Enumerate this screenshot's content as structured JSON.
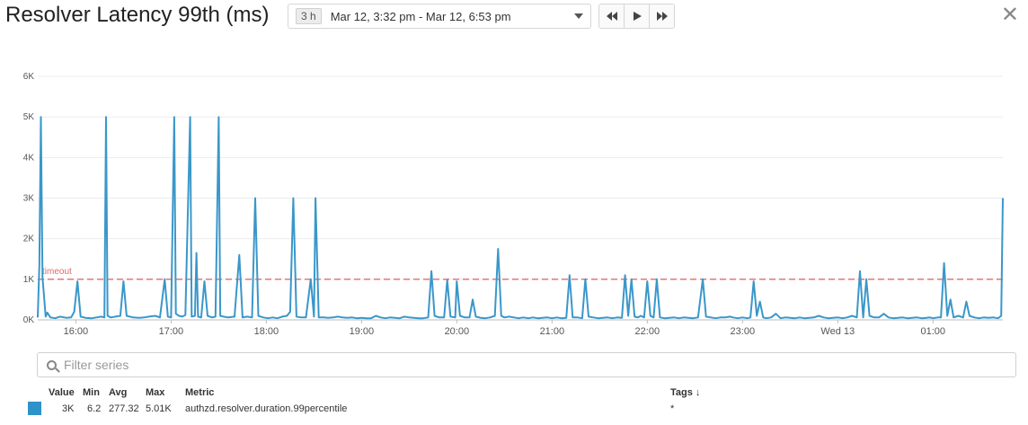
{
  "header": {
    "title": "Resolver Latency 99th (ms)",
    "range_badge": "3 h",
    "range_text": "Mar 12, 3:32 pm - Mar 12, 6:53 pm",
    "rewind_icon": "rewind-icon",
    "play_icon": "play-icon",
    "forward_icon": "fast-forward-icon",
    "close_icon": "close-icon"
  },
  "filter": {
    "placeholder": "Filter series"
  },
  "legend": {
    "headers": {
      "value": "Value",
      "min": "Min",
      "avg": "Avg",
      "max": "Max",
      "metric": "Metric",
      "tags": "Tags ↓"
    },
    "row": {
      "value": "3K",
      "min": "6.2",
      "avg": "277.32",
      "max": "5.01K",
      "metric": "authzd.resolver.duration.99percentile",
      "tags": "*"
    }
  },
  "colors": {
    "series": "#3a97c9",
    "timeout": "#e06a6a",
    "swatch": "#2e92c8",
    "grid": "#ececec"
  },
  "chart_data": {
    "type": "line",
    "ylim": [
      0,
      6000
    ],
    "yticks": [
      "0K",
      "1K",
      "2K",
      "3K",
      "4K",
      "5K",
      "6K"
    ],
    "xticks": [
      "16:00",
      "17:00",
      "18:00",
      "19:00",
      "20:00",
      "21:00",
      "22:00",
      "23:00",
      "Wed 13",
      "01:00"
    ],
    "threshold": {
      "label": "timeout",
      "value": 1000
    },
    "series": [
      {
        "points": [
          [
            "15:36",
            60
          ],
          [
            "15:37",
            1350
          ],
          [
            "15:38",
            5000
          ],
          [
            "15:39",
            1050
          ],
          [
            "15:41",
            80
          ],
          [
            "15:42",
            180
          ],
          [
            "15:44",
            60
          ],
          [
            "15:47",
            40
          ],
          [
            "15:50",
            80
          ],
          [
            "15:54",
            50
          ],
          [
            "15:57",
            60
          ],
          [
            "15:59",
            200
          ],
          [
            "16:01",
            950
          ],
          [
            "16:03",
            80
          ],
          [
            "16:06",
            50
          ],
          [
            "16:10",
            40
          ],
          [
            "16:13",
            60
          ],
          [
            "16:16",
            80
          ],
          [
            "16:18",
            60
          ],
          [
            "16:19",
            5000
          ],
          [
            "16:20",
            100
          ],
          [
            "16:22",
            60
          ],
          [
            "16:25",
            80
          ],
          [
            "16:28",
            100
          ],
          [
            "16:30",
            950
          ],
          [
            "16:32",
            100
          ],
          [
            "16:36",
            60
          ],
          [
            "16:40",
            50
          ],
          [
            "16:43",
            60
          ],
          [
            "16:46",
            80
          ],
          [
            "16:50",
            100
          ],
          [
            "16:53",
            60
          ],
          [
            "16:56",
            1000
          ],
          [
            "16:58",
            80
          ],
          [
            "17:00",
            60
          ],
          [
            "17:02",
            5000
          ],
          [
            "17:03",
            150
          ],
          [
            "17:05",
            100
          ],
          [
            "17:07",
            80
          ],
          [
            "17:09",
            120
          ],
          [
            "17:12",
            5000
          ],
          [
            "17:13",
            80
          ],
          [
            "17:15",
            100
          ],
          [
            "17:16",
            1650
          ],
          [
            "17:17",
            80
          ],
          [
            "17:19",
            60
          ],
          [
            "17:21",
            950
          ],
          [
            "17:23",
            100
          ],
          [
            "17:26",
            60
          ],
          [
            "17:28",
            80
          ],
          [
            "17:30",
            5000
          ],
          [
            "17:31",
            100
          ],
          [
            "17:33",
            80
          ],
          [
            "17:36",
            60
          ],
          [
            "17:40",
            80
          ],
          [
            "17:43",
            1600
          ],
          [
            "17:45",
            60
          ],
          [
            "17:48",
            80
          ],
          [
            "17:51",
            60
          ],
          [
            "17:53",
            3000
          ],
          [
            "17:55",
            100
          ],
          [
            "17:58",
            60
          ],
          [
            "18:01",
            40
          ],
          [
            "18:04",
            60
          ],
          [
            "18:07",
            40
          ],
          [
            "18:10",
            80
          ],
          [
            "18:13",
            100
          ],
          [
            "18:15",
            200
          ],
          [
            "18:17",
            3000
          ],
          [
            "18:19",
            80
          ],
          [
            "18:22",
            60
          ],
          [
            "18:25",
            60
          ],
          [
            "18:28",
            1000
          ],
          [
            "18:30",
            80
          ],
          [
            "18:31",
            3000
          ],
          [
            "18:33",
            60
          ],
          [
            "18:36",
            60
          ],
          [
            "18:39",
            50
          ],
          [
            "18:42",
            60
          ],
          [
            "18:45",
            80
          ],
          [
            "18:48",
            60
          ],
          [
            "18:51",
            50
          ],
          [
            "18:54",
            60
          ],
          [
            "18:57",
            40
          ],
          [
            "19:00",
            50
          ],
          [
            "19:03",
            40
          ],
          [
            "19:06",
            40
          ],
          [
            "19:09",
            100
          ],
          [
            "19:12",
            60
          ],
          [
            "19:15",
            40
          ],
          [
            "19:18",
            60
          ],
          [
            "19:21",
            50
          ],
          [
            "19:24",
            40
          ],
          [
            "19:27",
            80
          ],
          [
            "19:30",
            60
          ],
          [
            "19:33",
            50
          ],
          [
            "19:36",
            40
          ],
          [
            "19:39",
            40
          ],
          [
            "19:42",
            60
          ],
          [
            "19:44",
            1200
          ],
          [
            "19:46",
            100
          ],
          [
            "19:49",
            60
          ],
          [
            "19:52",
            60
          ],
          [
            "19:54",
            980
          ],
          [
            "19:56",
            80
          ],
          [
            "19:59",
            60
          ],
          [
            "20:00",
            950
          ],
          [
            "20:02",
            100
          ],
          [
            "20:05",
            60
          ],
          [
            "20:08",
            60
          ],
          [
            "20:10",
            500
          ],
          [
            "20:12",
            80
          ],
          [
            "20:15",
            50
          ],
          [
            "20:18",
            40
          ],
          [
            "20:21",
            60
          ],
          [
            "20:24",
            100
          ],
          [
            "20:26",
            1750
          ],
          [
            "20:28",
            100
          ],
          [
            "20:30",
            60
          ],
          [
            "20:33",
            80
          ],
          [
            "20:36",
            60
          ],
          [
            "20:39",
            40
          ],
          [
            "20:42",
            60
          ],
          [
            "20:45",
            40
          ],
          [
            "20:48",
            60
          ],
          [
            "20:51",
            40
          ],
          [
            "20:54",
            50
          ],
          [
            "20:57",
            60
          ],
          [
            "21:00",
            40
          ],
          [
            "21:03",
            60
          ],
          [
            "21:06",
            40
          ],
          [
            "21:09",
            50
          ],
          [
            "21:11",
            1100
          ],
          [
            "21:13",
            60
          ],
          [
            "21:16",
            60
          ],
          [
            "21:19",
            40
          ],
          [
            "21:21",
            1000
          ],
          [
            "21:23",
            80
          ],
          [
            "21:26",
            60
          ],
          [
            "21:29",
            40
          ],
          [
            "21:32",
            50
          ],
          [
            "21:35",
            60
          ],
          [
            "21:38",
            40
          ],
          [
            "21:41",
            60
          ],
          [
            "21:44",
            50
          ],
          [
            "21:46",
            1100
          ],
          [
            "21:48",
            100
          ],
          [
            "21:50",
            1000
          ],
          [
            "21:52",
            80
          ],
          [
            "21:54",
            60
          ],
          [
            "21:56",
            100
          ],
          [
            "21:58",
            60
          ],
          [
            "22:00",
            950
          ],
          [
            "22:02",
            100
          ],
          [
            "22:04",
            60
          ],
          [
            "22:06",
            1000
          ],
          [
            "22:08",
            60
          ],
          [
            "22:11",
            40
          ],
          [
            "22:14",
            50
          ],
          [
            "22:17",
            60
          ],
          [
            "22:20",
            40
          ],
          [
            "22:23",
            60
          ],
          [
            "22:26",
            50
          ],
          [
            "22:29",
            40
          ],
          [
            "22:32",
            60
          ],
          [
            "22:35",
            1000
          ],
          [
            "22:37",
            80
          ],
          [
            "22:40",
            60
          ],
          [
            "22:43",
            40
          ],
          [
            "22:46",
            60
          ],
          [
            "22:49",
            60
          ],
          [
            "22:52",
            80
          ],
          [
            "22:54",
            60
          ],
          [
            "22:57",
            40
          ],
          [
            "23:00",
            60
          ],
          [
            "23:03",
            40
          ],
          [
            "23:05",
            60
          ],
          [
            "23:07",
            950
          ],
          [
            "23:09",
            100
          ],
          [
            "23:11",
            450
          ],
          [
            "23:13",
            60
          ],
          [
            "23:15",
            40
          ],
          [
            "23:18",
            60
          ],
          [
            "23:21",
            150
          ],
          [
            "23:24",
            40
          ],
          [
            "23:27",
            60
          ],
          [
            "23:30",
            50
          ],
          [
            "23:33",
            40
          ],
          [
            "23:36",
            60
          ],
          [
            "23:39",
            40
          ],
          [
            "23:42",
            50
          ],
          [
            "23:45",
            60
          ],
          [
            "23:48",
            100
          ],
          [
            "23:51",
            60
          ],
          [
            "23:54",
            40
          ],
          [
            "23:57",
            50
          ],
          [
            "00:00",
            60
          ],
          [
            "00:03",
            40
          ],
          [
            "00:06",
            60
          ],
          [
            "00:09",
            100
          ],
          [
            "00:12",
            60
          ],
          [
            "00:14",
            1200
          ],
          [
            "00:16",
            60
          ],
          [
            "00:18",
            1000
          ],
          [
            "00:20",
            100
          ],
          [
            "00:23",
            60
          ],
          [
            "00:26",
            60
          ],
          [
            "00:29",
            150
          ],
          [
            "00:32",
            60
          ],
          [
            "00:35",
            40
          ],
          [
            "00:38",
            50
          ],
          [
            "00:41",
            60
          ],
          [
            "00:44",
            40
          ],
          [
            "00:47",
            50
          ],
          [
            "00:50",
            60
          ],
          [
            "00:53",
            40
          ],
          [
            "00:56",
            50
          ],
          [
            "00:58",
            60
          ],
          [
            "01:00",
            40
          ],
          [
            "01:03",
            60
          ],
          [
            "01:05",
            60
          ],
          [
            "01:07",
            1400
          ],
          [
            "01:09",
            100
          ],
          [
            "01:11",
            500
          ],
          [
            "01:13",
            60
          ],
          [
            "01:16",
            100
          ],
          [
            "01:19",
            60
          ],
          [
            "01:21",
            450
          ],
          [
            "01:23",
            100
          ],
          [
            "01:26",
            60
          ],
          [
            "01:29",
            40
          ],
          [
            "01:32",
            60
          ],
          [
            "01:35",
            50
          ],
          [
            "01:38",
            60
          ],
          [
            "01:41",
            40
          ],
          [
            "01:43",
            100
          ],
          [
            "01:44",
            3000
          ]
        ]
      }
    ]
  }
}
